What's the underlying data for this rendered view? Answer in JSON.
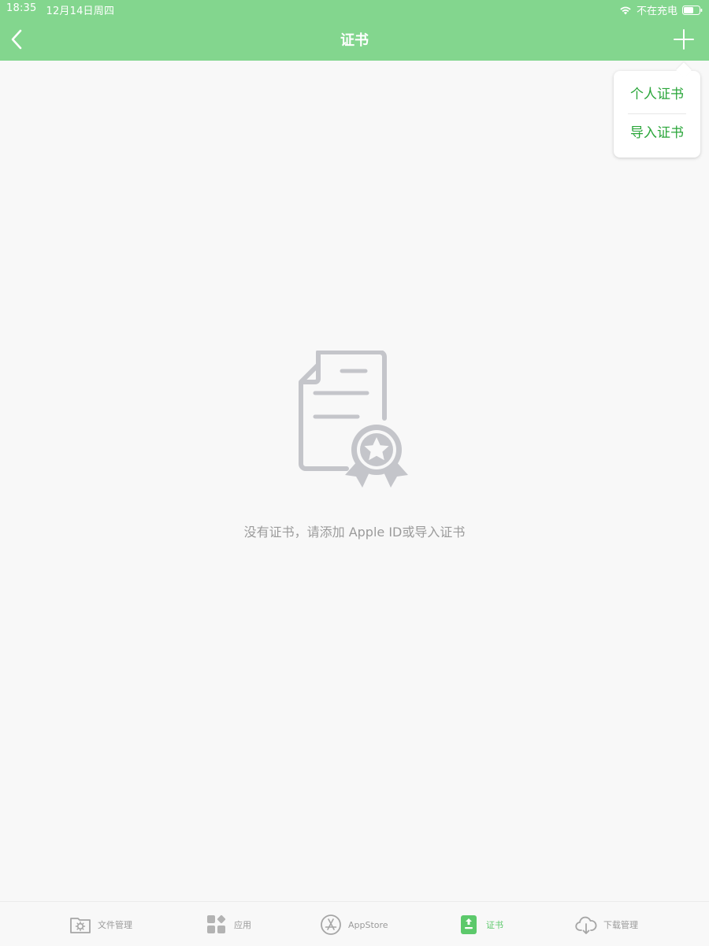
{
  "status_bar": {
    "time": "18:35",
    "date": "12月14日周四",
    "charging_status": "不在充电",
    "icons": [
      "wifi-icon",
      "battery-icon"
    ]
  },
  "header": {
    "title": "证书",
    "back_icon": "chevron-left-icon",
    "add_icon": "plus-icon",
    "background_color": "#83d68e"
  },
  "popover_menu": {
    "items": [
      {
        "label": "个人证书"
      },
      {
        "label": "导入证书"
      }
    ],
    "item_color": "#2aa63a"
  },
  "empty_state": {
    "icon": "certificate-icon",
    "message": "没有证书，请添加 Apple ID或导入证书"
  },
  "tab_bar": {
    "tabs": [
      {
        "label": "文件管理",
        "icon": "folder-gear-icon",
        "active": false
      },
      {
        "label": "应用",
        "icon": "apps-grid-icon",
        "active": false
      },
      {
        "label": "AppStore",
        "icon": "appstore-icon",
        "active": false
      },
      {
        "label": "证书",
        "icon": "certificate-tab-icon",
        "active": true
      },
      {
        "label": "下载管理",
        "icon": "cloud-download-icon",
        "active": false
      }
    ],
    "active_color": "#5cc96b",
    "inactive_color": "#9a9a9a"
  }
}
